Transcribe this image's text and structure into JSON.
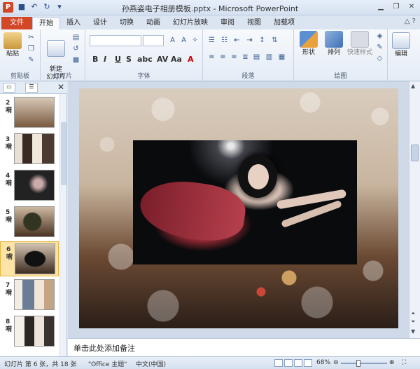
{
  "window": {
    "title": "孙燕姿电子相册模板.pptx - Microsoft PowerPoint",
    "app_icon": "P",
    "controls": [
      "minimize-icon",
      "restore-icon",
      "close-icon"
    ]
  },
  "tabs": [
    "文件",
    "开始",
    "插入",
    "设计",
    "切换",
    "动画",
    "幻灯片放映",
    "审阅",
    "视图",
    "加载项"
  ],
  "active_tab": "开始",
  "ribbon": {
    "groups": {
      "clipboard": "剪贴板",
      "slides": "幻灯片",
      "font": "字体",
      "paragraph": "段落",
      "drawing": "绘图",
      "editing": "编辑"
    },
    "paste_label": "粘贴",
    "new_slide_label": "新建\n幻灯片",
    "shape_label": "形状",
    "arrange_label": "排列",
    "quick_style_label": "快速样式",
    "edit_label": "编辑"
  },
  "slides": [
    {
      "num": "2",
      "suffix": "嗬"
    },
    {
      "num": "3",
      "suffix": "嗬"
    },
    {
      "num": "4",
      "suffix": "嗬"
    },
    {
      "num": "5",
      "suffix": "嗬"
    },
    {
      "num": "6",
      "suffix": "嗬",
      "selected": true
    },
    {
      "num": "7",
      "suffix": "嗬"
    },
    {
      "num": "8",
      "suffix": "嗬"
    }
  ],
  "notes_placeholder": "单击此处添加备注",
  "status": {
    "slide_info": "幻灯片 第 6 张，共 18 张",
    "theme": "\"Office 主题\"",
    "language": "中文(中国)",
    "zoom": "68%",
    "zoom_fraction": 0.68
  },
  "colors": {
    "file_tab": "#d24726",
    "selected_thumb": "#fce4a7",
    "ribbon_bg": "#f7f9fc"
  }
}
